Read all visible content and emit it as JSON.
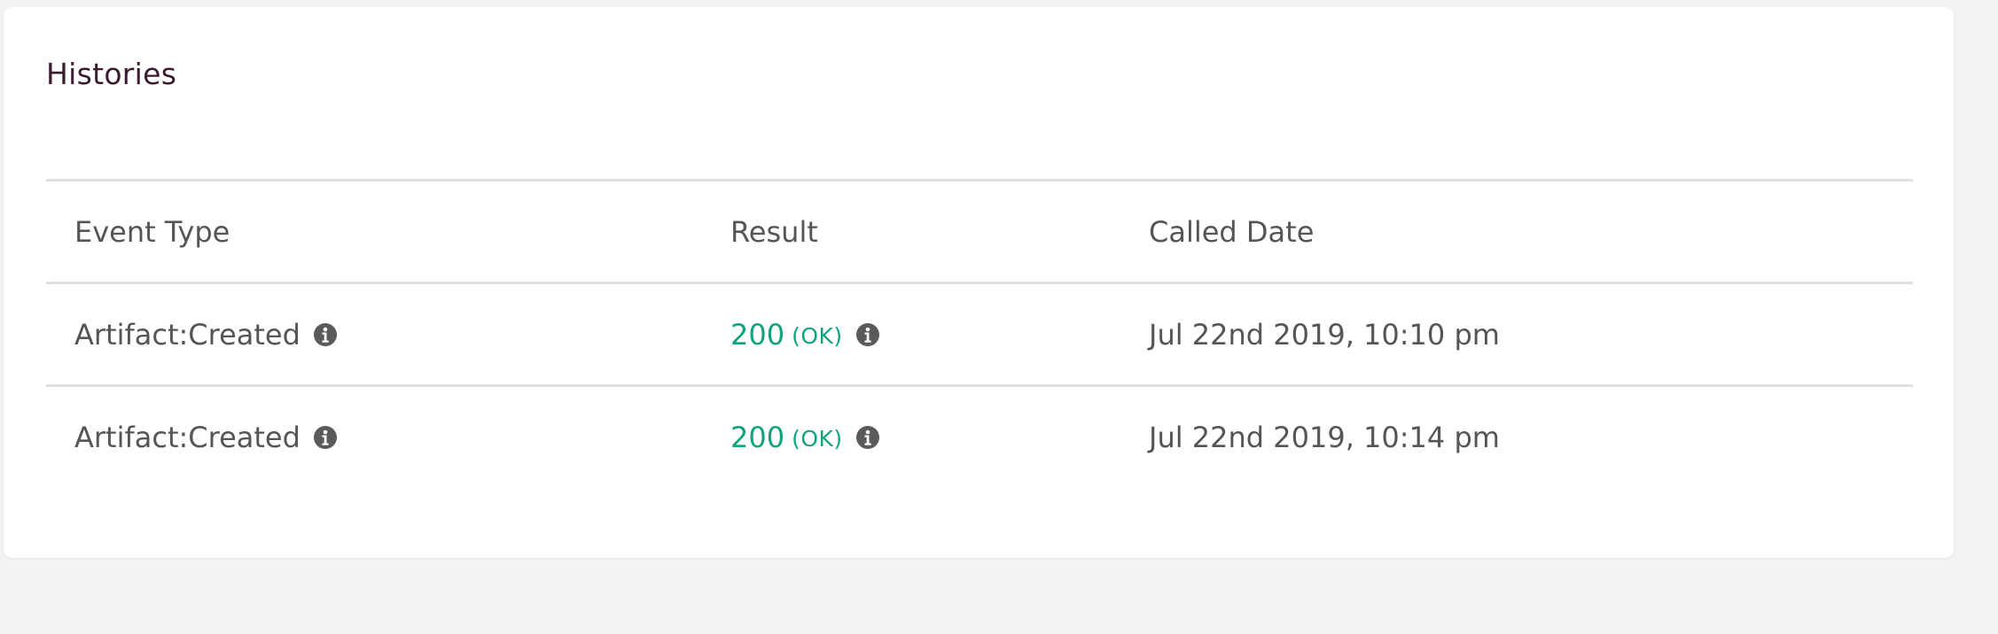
{
  "card": {
    "title": "Histories"
  },
  "table": {
    "headers": {
      "event_type": "Event Type",
      "result": "Result",
      "called_date": "Called Date"
    },
    "rows": [
      {
        "event_type": "Artifact:Created",
        "event_icon": "info-circle-icon",
        "result_code": "200",
        "result_text": "(OK)",
        "result_icon": "info-circle-icon",
        "called_date": "Jul 22nd 2019, 10:10 pm"
      },
      {
        "event_type": "Artifact:Created",
        "event_icon": "info-circle-icon",
        "result_code": "200",
        "result_text": "(OK)",
        "result_icon": "info-circle-icon",
        "called_date": "Jul 22nd 2019, 10:14 pm"
      }
    ]
  },
  "colors": {
    "success": "#10a37f",
    "title": "#3a1b2e",
    "text": "#555555",
    "icon": "#5a5a5a",
    "divider": "#e0e0e0",
    "background": "#f2f2f2"
  }
}
